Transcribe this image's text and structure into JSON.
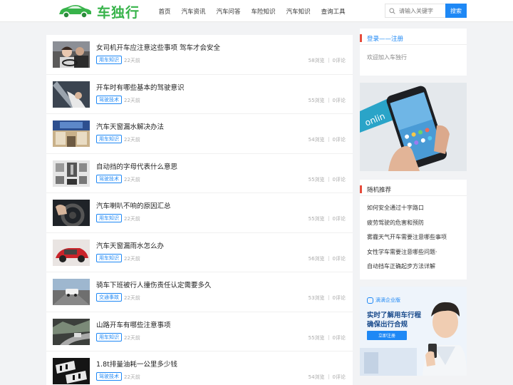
{
  "header": {
    "site_name": "车独行",
    "nav": [
      "首页",
      "汽车资讯",
      "汽车问答",
      "车险知识",
      "汽车知识",
      "查询工具"
    ],
    "search_placeholder": "请输入关键字",
    "search_button": "搜索"
  },
  "articles": [
    {
      "title": "女司机开车应注意这些事项 驾车才会安全",
      "tag": "用车知识",
      "time": "22天前",
      "views": "58浏览",
      "comments": "0评论",
      "thumb": "thumb-driver-woman"
    },
    {
      "title": "开车时有哪些基本的驾驶意识",
      "tag": "驾驶技术",
      "time": "22天前",
      "views": "55浏览",
      "comments": "0评论",
      "thumb": "thumb-seatbelt"
    },
    {
      "title": "汽车天窗漏水解决办法",
      "tag": "用车知识",
      "time": "22天前",
      "views": "54浏览",
      "comments": "0评论",
      "thumb": "thumb-sunroof"
    },
    {
      "title": "自动挡的字母代表什么意思",
      "tag": "驾驶技术",
      "time": "22天前",
      "views": "55浏览",
      "comments": "0评论",
      "thumb": "thumb-gear-shift"
    },
    {
      "title": "汽车喇叭不响的原因汇总",
      "tag": "用车知识",
      "time": "22天前",
      "views": "55浏览",
      "comments": "0评论",
      "thumb": "thumb-steering-wheel"
    },
    {
      "title": "汽车天窗漏雨水怎么办",
      "tag": "用车知识",
      "time": "22天前",
      "views": "56浏览",
      "comments": "0评论",
      "thumb": "thumb-red-car"
    },
    {
      "title": "骑车下班被行人撞伤责任认定需要多久",
      "tag": "交通事故",
      "time": "22天前",
      "views": "53浏览",
      "comments": "0评论",
      "thumb": "thumb-road-car"
    },
    {
      "title": "山路开车有哪些注意事项",
      "tag": "用车知识",
      "time": "22天前",
      "views": "55浏览",
      "comments": "0评论",
      "thumb": "thumb-mountain-road"
    },
    {
      "title": "1.8t排量油耗一公里多少钱",
      "tag": "驾驶技术",
      "time": "22天前",
      "views": "54浏览",
      "comments": "0评论",
      "thumb": "thumb-engine-badge"
    }
  ],
  "sidebar": {
    "login_link": "登录",
    "separator": "——",
    "register_link": "注册",
    "welcome": "欢迎加入车独行",
    "random_title": "随机推荐",
    "random_items": [
      "如何安全通过十字路口",
      "疲劳驾驶的危害和预防",
      "雾霾天气开车需要注意哪些事项",
      "女性学车需要注意哪些问题·",
      "自动挡车正确起步方法详解"
    ],
    "ad": {
      "brand": "滴滴企业版",
      "line1": "实时了解用车行程",
      "line2": "确保出行合规",
      "button": "立即注册"
    }
  },
  "colors": {
    "brand_green": "#37b34a",
    "accent_blue": "#1e88f5",
    "marker_red": "#e74c3c"
  }
}
